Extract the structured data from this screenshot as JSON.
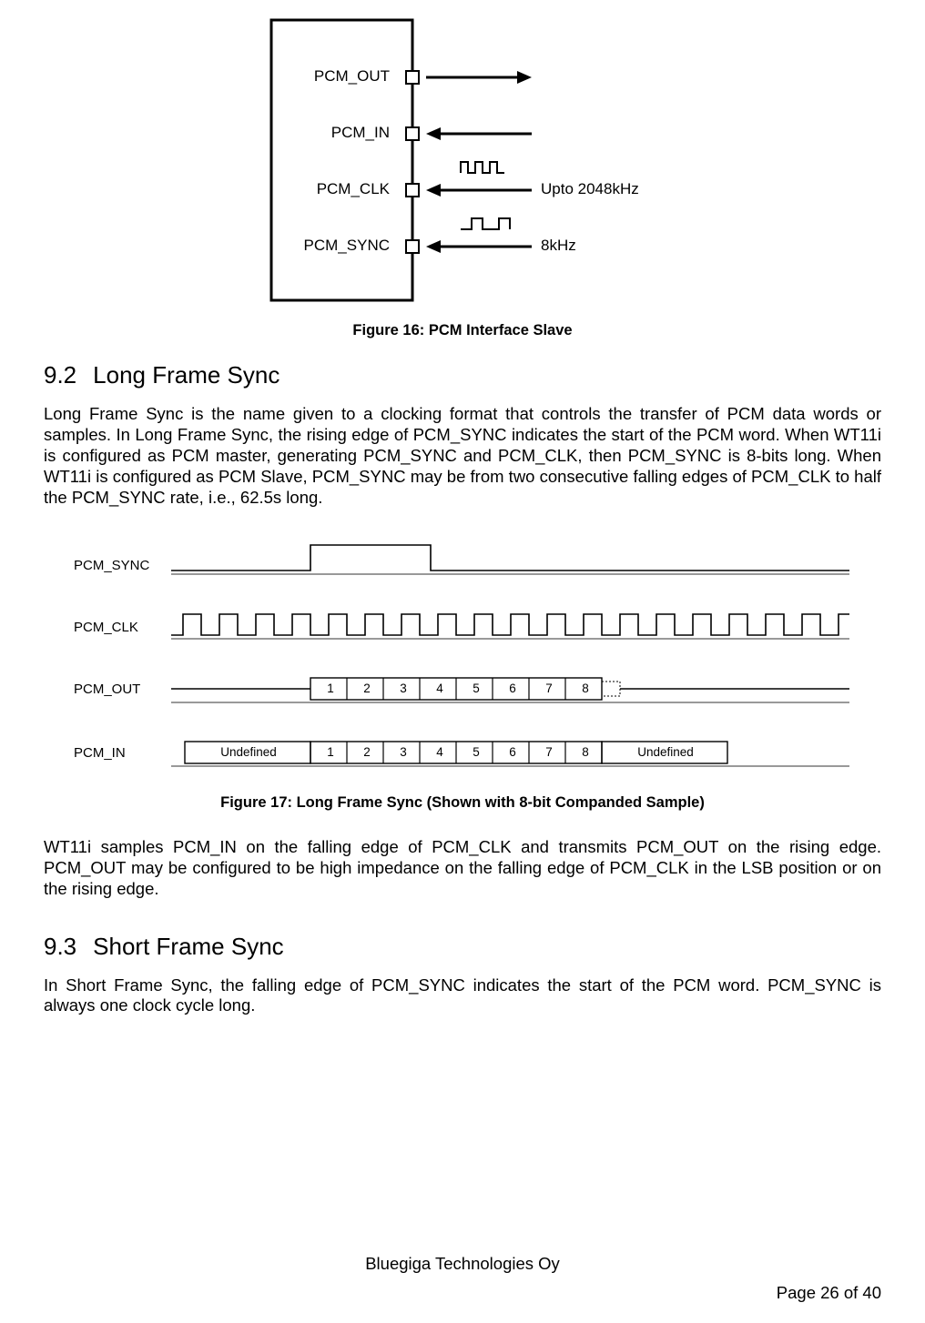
{
  "fig16": {
    "signals": {
      "out": "PCM_OUT",
      "in": "PCM_IN",
      "clk": "PCM_CLK",
      "sync": "PCM_SYNC"
    },
    "notes": {
      "clk": "Upto 2048kHz",
      "sync": "8kHz"
    },
    "caption": "Figure 16: PCM Interface Slave"
  },
  "section92": {
    "number": "9.2",
    "title": "Long Frame Sync",
    "para1": "Long Frame Sync is the name given to a clocking format that controls the transfer of PCM data words or samples. In Long Frame Sync, the rising edge of PCM_SYNC indicates the start of the PCM word. When WT11i is configured as PCM master, generating PCM_SYNC and PCM_CLK, then PCM_SYNC is 8-bits long. When WT11i is configured as PCM Slave, PCM_SYNC may be from two consecutive falling edges of PCM_CLK to half the PCM_SYNC rate, i.e., 62.5s long."
  },
  "fig17": {
    "labels": {
      "sync": "PCM_SYNC",
      "clk": "PCM_CLK",
      "out": "PCM_OUT",
      "in": "PCM_IN"
    },
    "bits": [
      "1",
      "2",
      "3",
      "4",
      "5",
      "6",
      "7",
      "8"
    ],
    "undefined": "Undefined",
    "caption": "Figure 17: Long Frame Sync (Shown with 8-bit Companded Sample)"
  },
  "section92_cont": {
    "para2": "WT11i samples PCM_IN on the falling edge of PCM_CLK and transmits PCM_OUT on the rising edge. PCM_OUT may be configured to be high impedance on the falling edge of PCM_CLK in the LSB position or on the rising edge."
  },
  "section93": {
    "number": "9.3",
    "title": "Short Frame Sync",
    "para1": "In Short Frame Sync, the falling edge of PCM_SYNC indicates the start of the PCM word. PCM_SYNC is always one clock cycle long."
  },
  "footer": {
    "center": "Bluegiga Technologies Oy",
    "right": "Page 26 of 40"
  }
}
